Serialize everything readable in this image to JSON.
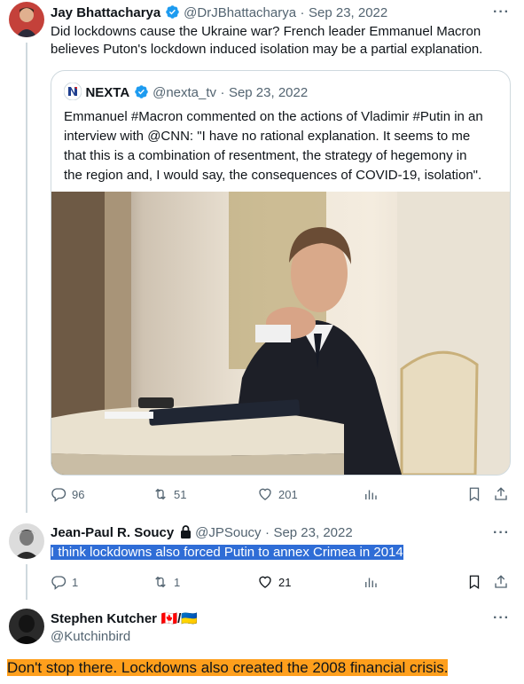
{
  "tweet1": {
    "name": "Jay Bhattacharya",
    "handle": "@DrJBhattacharya",
    "date": "Sep 23, 2022",
    "text_line1": "Did lockdowns cause the Ukraine war? French leader Emmanuel Macron",
    "text_line2": "believes Puton's lockdown induced isolation may be a partial explanation.",
    "more": "···"
  },
  "quote": {
    "name": "NEXTA",
    "handle": "@nexta_tv",
    "date": "Sep 23, 2022",
    "line1": "Emmanuel #Macron commented on the actions of Vladimir #Putin in an",
    "line2": "interview with @CNN: \"I have no rational explanation. It seems to me",
    "line3": "that this is a combination of resentment, the strategy of hegemony in",
    "line4": "the region and, I would say, the consequences of COVID-19, isolation\"."
  },
  "tweet1_actions": {
    "replies": "96",
    "reposts": "51",
    "likes": "201"
  },
  "tweet2": {
    "name": "Jean-Paul R. Soucy",
    "handle": "@JPSoucy",
    "date": "Sep 23, 2022",
    "text": "I think lockdowns also forced Putin to annex Crimea in 2014",
    "more": "···"
  },
  "tweet2_actions": {
    "replies": "1",
    "reposts": "1",
    "likes": "21"
  },
  "tweet3": {
    "name": "Stephen Kutcher",
    "flags": "🇨🇦/🇺🇦",
    "handle": "@Kutchinbird",
    "text": "Don't stop there. Lockdowns also created the 2008 financial crisis.",
    "more": "···"
  },
  "colors": {
    "accent": "#1d9bf0",
    "highlight_blue": "#2f6dd6",
    "highlight_orange": "#ff9f1c",
    "like_active": "#0f1419"
  },
  "icons": [
    "reply-icon",
    "repost-icon",
    "like-icon",
    "views-icon",
    "bookmark-icon",
    "share-icon",
    "verified-icon",
    "lock-icon"
  ]
}
